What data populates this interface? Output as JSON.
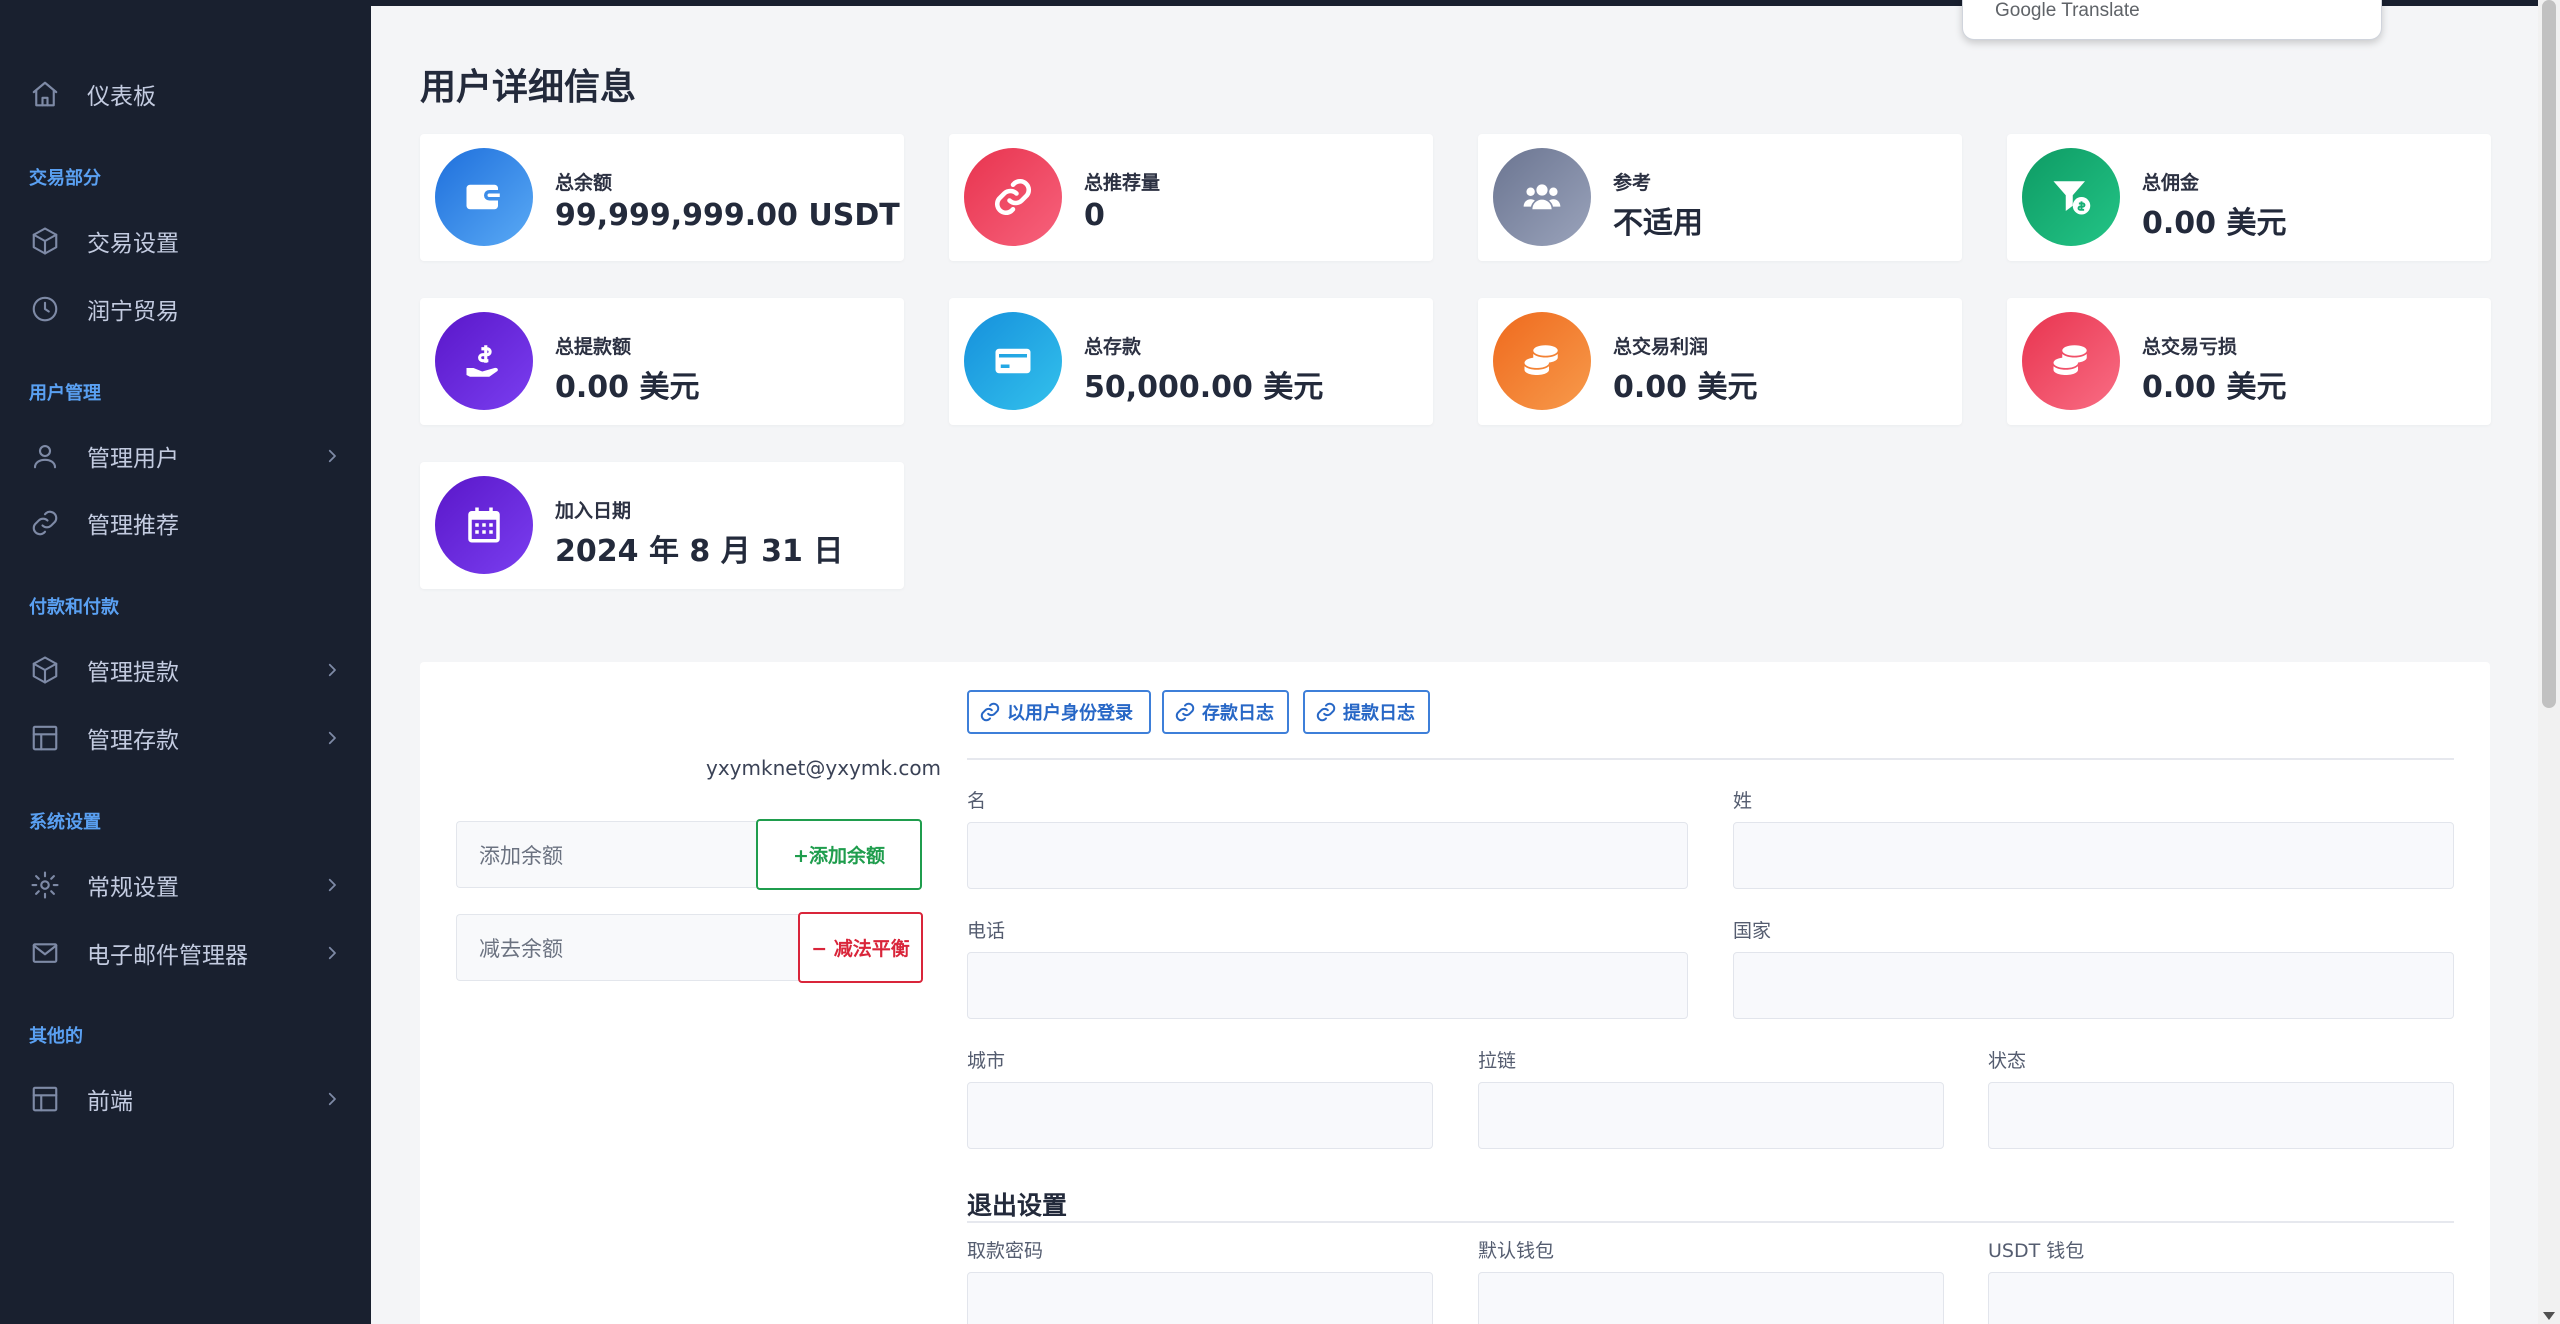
{
  "sidebar": {
    "dashboard": "仪表板",
    "sections": {
      "trading": "交易部分",
      "users": "用户管理",
      "payments": "付款和付款",
      "system": "系统设置",
      "other": "其他的"
    },
    "items": {
      "trade_settings": "交易设置",
      "runing_trade": "润宁贸易",
      "manage_users": "管理用户",
      "manage_referrals": "管理推荐",
      "manage_withdrawals": "管理提款",
      "manage_deposits": "管理存款",
      "general_settings": "常规设置",
      "email_manager": "电子邮件管理器",
      "frontend": "前端"
    }
  },
  "translate_popup": "Google Translate",
  "page_title": "用户详细信息",
  "cards": [
    {
      "label": "总余额",
      "value": "99,999,999.00 USDT",
      "icon": "wallet-icon",
      "color": "#2b86e8"
    },
    {
      "label": "总推荐量",
      "value": "0",
      "icon": "link-icon",
      "color": "#ee4561"
    },
    {
      "label": "参考",
      "value": "不适用",
      "icon": "users-icon",
      "color": "#7e87a2"
    },
    {
      "label": "总佣金",
      "value": "0.00 美元",
      "icon": "funnel-dollar-icon",
      "color": "#17ae74"
    },
    {
      "label": "总提款额",
      "value": "0.00 美元",
      "icon": "hand-dollar-icon",
      "color": "#6524d8"
    },
    {
      "label": "总存款",
      "value": "50,000.00 美元",
      "icon": "credit-card-icon",
      "color": "#22a6e4"
    },
    {
      "label": "总交易利润",
      "value": "0.00 美元",
      "icon": "coins-icon",
      "color": "#f27d30"
    },
    {
      "label": "总交易亏损",
      "value": "0.00 美元",
      "icon": "coins-icon",
      "color": "#ee4561"
    },
    {
      "label": "加入日期",
      "value": "2024 年 8 月 31 日",
      "icon": "calendar-icon",
      "color": "#6524d8"
    }
  ],
  "user": {
    "email": "yxymknet@yxymk.com",
    "add_balance_placeholder": "添加余额",
    "add_balance_button": "+添加余额",
    "sub_balance_placeholder": "减去余额",
    "sub_balance_button": "− 减法平衡"
  },
  "actions": {
    "login_as_user": "以用户身份登录",
    "deposit_log": "存款日志",
    "withdraw_log": "提款日志"
  },
  "form": {
    "first_name": "名",
    "last_name": "姓",
    "phone": "电话",
    "country": "国家",
    "city": "城市",
    "zip": "拉链",
    "state": "状态",
    "withdraw_section": "退出设置",
    "withdraw_password": "取款密码",
    "default_wallet": "默认钱包",
    "usdt_wallet": "USDT 钱包"
  }
}
